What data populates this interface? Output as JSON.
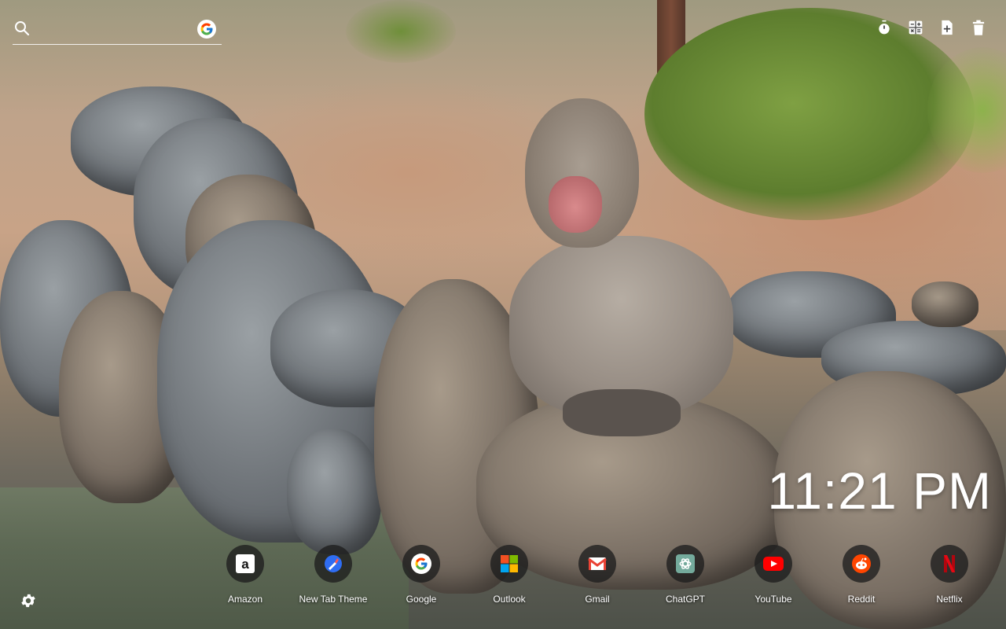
{
  "search": {
    "placeholder": "",
    "value": "",
    "icon": "search-icon",
    "engine_icon": "google-icon"
  },
  "toolbar": {
    "items": [
      {
        "icon": "timer-icon"
      },
      {
        "icon": "calculator-icon"
      },
      {
        "icon": "add-note-icon"
      },
      {
        "icon": "trash-icon"
      }
    ]
  },
  "clock": {
    "time": "11:21 PM"
  },
  "apps": [
    {
      "label": "Amazon",
      "icon": "amazon-icon"
    },
    {
      "label": "New Tab Theme",
      "icon": "new-tab-theme-icon"
    },
    {
      "label": "Google",
      "icon": "google-icon"
    },
    {
      "label": "Outlook",
      "icon": "outlook-icon"
    },
    {
      "label": "Gmail",
      "icon": "gmail-icon"
    },
    {
      "label": "ChatGPT",
      "icon": "chatgpt-icon"
    },
    {
      "label": "YouTube",
      "icon": "youtube-icon"
    },
    {
      "label": "Reddit",
      "icon": "reddit-icon"
    },
    {
      "label": "Netflix",
      "icon": "netflix-icon"
    }
  ],
  "settings": {
    "icon": "gear-icon"
  },
  "colors": {
    "youtube": "#ff0000",
    "netflix": "#e50914",
    "reddit": "#ff4500",
    "gmail": "#ea4335",
    "chatgpt": "#74aa9c"
  }
}
